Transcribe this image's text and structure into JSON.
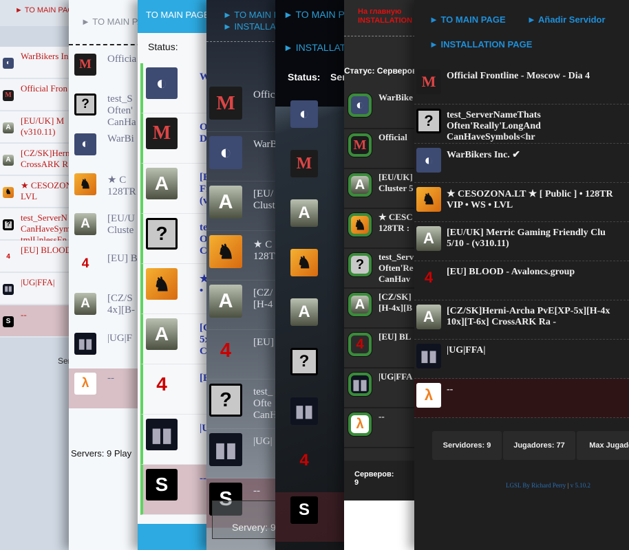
{
  "panels": [
    {
      "theme": "classic",
      "links": [
        "► TO MAIN PAGE"
      ],
      "footer": "Ser",
      "rows": [
        {
          "game": "tribes",
          "name": "WarBikers In"
        },
        {
          "game": "metro",
          "name": "Official Fron"
        },
        {
          "game": "ark",
          "name": "[EU/UK]   M\n(v310.11)"
        },
        {
          "game": "ark",
          "name": "[CZ/SK]Herni\nCrossARK R"
        },
        {
          "game": "csgo",
          "name": "★ CESOZON\nLVL"
        },
        {
          "game": "unknown",
          "name": "test_ServerN\nCanHaveSym\ntmlUnlessEn"
        },
        {
          "game": "l4d2",
          "name": "[EU] BLOOD"
        },
        {
          "game": "ut",
          "name": "|UG|FFA|"
        },
        {
          "game": "source",
          "name": "--",
          "offline": true
        }
      ]
    },
    {
      "theme": "light",
      "links": [
        "► TO MAIN PAGE"
      ],
      "footer": "Servers: 9  Play",
      "rows": [
        {
          "game": "metro",
          "name": "Officia"
        },
        {
          "game": "unknown",
          "name": "test_S\nOften'\nCanHa"
        },
        {
          "game": "tribes",
          "name": "WarBi"
        },
        {
          "game": "csgo",
          "name": "★   C\n128TR"
        },
        {
          "game": "ark",
          "name": "[EU/U\nCluste"
        },
        {
          "game": "l4d2",
          "name": "[EU] B"
        },
        {
          "game": "ark",
          "name": "[CZ/S\n4x][B-"
        },
        {
          "game": "ut",
          "name": "|UG|F"
        },
        {
          "game": "hl2",
          "name": "--",
          "offline": true
        }
      ]
    },
    {
      "theme": "blue",
      "links": [
        "TO MAIN PAGE"
      ],
      "status": "Status:",
      "rows": [
        {
          "game": "tribes",
          "name": "W"
        },
        {
          "game": "metro",
          "name": "O\nD"
        },
        {
          "game": "ark",
          "name": "[E\nFr\n(v"
        },
        {
          "game": "unknown",
          "name": "te\nO\nC"
        },
        {
          "game": "csgo",
          "name": "★\n• 1"
        },
        {
          "game": "ark",
          "name": "[C\n5x\nC"
        },
        {
          "game": "l4d2",
          "name": "[E"
        },
        {
          "game": "ut",
          "name": "|U"
        },
        {
          "game": "source",
          "name": "--",
          "offline": true
        }
      ]
    },
    {
      "theme": "slate",
      "links": [
        "► TO MAIN PAGE",
        "► INSTALLATION"
      ],
      "footer": "Servery: 9",
      "rows": [
        {
          "game": "metro",
          "name": "Offic"
        },
        {
          "game": "tribes",
          "name": "WarB"
        },
        {
          "game": "ark",
          "name": "[EU/\nClust"
        },
        {
          "game": "csgo",
          "name": "★ C\n128T"
        },
        {
          "game": "ark",
          "name": "[CZ/\n[H-4"
        },
        {
          "game": "l4d2",
          "name": "[EU]"
        },
        {
          "game": "unknown",
          "name": "test_\nOfte\nCanH"
        },
        {
          "game": "ut",
          "name": "|UG|"
        },
        {
          "game": "source",
          "name": "--",
          "offline": true
        }
      ]
    },
    {
      "theme": "image",
      "links": [
        "► TO MAIN PAGE",
        "► INSTALLATION"
      ],
      "status": "Status:",
      "status2": "Ser",
      "rows": [
        {
          "game": "tribes",
          "name": "W"
        },
        {
          "game": "metro",
          "name": "Of\nDi"
        },
        {
          "game": "ark",
          "name": "[E\nFr"
        },
        {
          "game": "csgo",
          "name": "★\n• 1"
        },
        {
          "game": "ark",
          "name": "[C\n5x\nCr"
        },
        {
          "game": "unknown",
          "name": "tes\nOf\nCa"
        },
        {
          "game": "ut",
          "name": "|U"
        },
        {
          "game": "l4d2",
          "name": "[E"
        },
        {
          "game": "source",
          "name": "--",
          "offline": true
        }
      ]
    },
    {
      "theme": "dark-ru",
      "links": [
        "На главную",
        "INSTALLATION"
      ],
      "status": "Статус: Серверов",
      "footer": "Серверов:\n9",
      "rows": [
        {
          "game": "tribes",
          "name": "WarBike"
        },
        {
          "game": "metro",
          "name": "Official"
        },
        {
          "game": "ark",
          "name": "[EU/UK]\nCluster 5"
        },
        {
          "game": "csgo",
          "name": "★ CESC\n128TR :"
        },
        {
          "game": "unknown",
          "name": "test_Serv\nOften'Re\nCanHav"
        },
        {
          "game": "ark",
          "name": "[CZ/SK]\n[H-4x][B"
        },
        {
          "game": "l4d2",
          "name": "[EU] BL"
        },
        {
          "game": "ut",
          "name": "|UG|FFA"
        },
        {
          "game": "hl2",
          "name": "--",
          "offline": true
        }
      ]
    },
    {
      "theme": "dark-es",
      "links": [
        "► TO MAIN PAGE",
        "► Añadir Servidor",
        "► INSTALLATION PAGE"
      ],
      "rows": [
        {
          "game": "metro",
          "name": "Official Frontline - Moscow - Dia 4"
        },
        {
          "game": "unknown",
          "name": "test_ServerNameThats\nOften'Really'LongAnd\nCanHaveSymbols<hr"
        },
        {
          "game": "tribes",
          "name": "WarBikers Inc. ✔"
        },
        {
          "game": "csgo",
          "name": "★ CESOZONA.LT ★ [ Public ] • 128TR\nVIP • WS • LVL"
        },
        {
          "game": "ark",
          "name": "[EU/UK] Merric Gaming Friendly Clu\n5/10 - (v310.11)"
        },
        {
          "game": "l4d2",
          "name": "[EU] BLOOD - Avaloncs.group"
        },
        {
          "game": "ark",
          "name": "[CZ/SK]Herni-Archa  PvE[XP-5x][H-4x\n10x][T-6x] CrossARK Ra -"
        },
        {
          "game": "ut",
          "name": "|UG|FFA|"
        },
        {
          "game": "hl2",
          "name": "--",
          "offline": true
        }
      ],
      "stats": [
        "Servidores: 9",
        "Jugadores: 77",
        "Max Jugado"
      ],
      "credit": "LGSL By Richard Perry",
      "version": "v 5.10.2"
    }
  ],
  "colors": {
    "online": "#5fd45f",
    "offline_row": "#d8c0c6",
    "link_blue": "#1f8fd8",
    "link_red": "#e01010"
  }
}
